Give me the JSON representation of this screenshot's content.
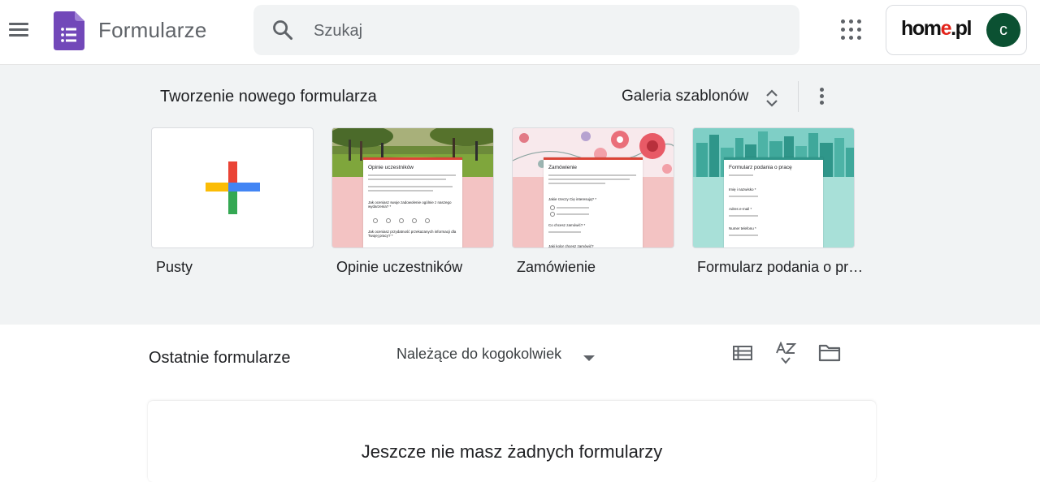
{
  "header": {
    "app_title": "Formularze",
    "search_placeholder": "Szukaj",
    "brand_prefix": "hom",
    "brand_accent": "e",
    "brand_suffix": ".pl",
    "avatar_initial": "c",
    "icons": {
      "menu": "hamburger-menu-icon",
      "logo": "google-forms-logo-icon",
      "search": "search-icon",
      "apps": "apps-grid-icon"
    }
  },
  "templates": {
    "section_title": "Tworzenie nowego formularza",
    "gallery_label": "Galeria szablonów",
    "items": [
      {
        "label": "Pusty"
      },
      {
        "label": "Opinie uczestników",
        "preview_title": "Opinie uczestników",
        "preview_q1": "Jak oceniasz swoje zadowolenie ogólnie z naszego wydarzenia? *",
        "preview_q2": "Jak oceniasz przydatność przekazanych informacji dla Twojej pracy? *"
      },
      {
        "label": "Zamówienie",
        "preview_title": "Zamówienie",
        "preview_q1": "Jakie rzeczy Cię interesują? *",
        "preview_q2": "Co chcesz zamówić? *",
        "preview_q3": "Jaki kolor chcesz zamówić?"
      },
      {
        "label": "Formularz podania o pracę",
        "preview_title": "Formularz podania o pracę",
        "preview_q1": "Imię i nazwisko *",
        "preview_q2": "Adres e-mail *",
        "preview_q3": "Numer telefonu *"
      }
    ]
  },
  "recent": {
    "title": "Ostatnie formularze",
    "owner_filter": "Należące do kogokolwiek",
    "empty_message": "Jeszcze nie masz żadnych formularzy"
  },
  "colors": {
    "forms_purple": "#7248b9",
    "avatar_green": "#0b5132",
    "brand_red": "#e2231a",
    "section_bg": "#f1f3f4"
  }
}
